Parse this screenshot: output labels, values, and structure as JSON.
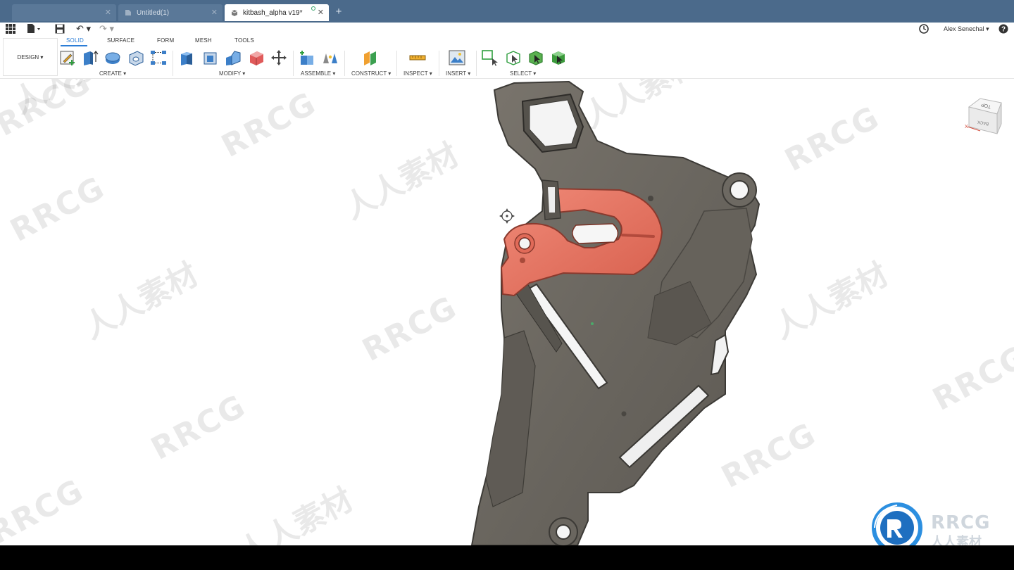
{
  "tabs": [
    {
      "label": "",
      "active": false
    },
    {
      "label": "Untitled(1)",
      "active": false
    },
    {
      "label": "kitbash_alpha v19*",
      "active": true
    }
  ],
  "user": {
    "name": "Alex Senechal"
  },
  "workspace": {
    "label": "DESIGN"
  },
  "ribbon_tabs": [
    {
      "label": "SOLID",
      "active": true
    },
    {
      "label": "SURFACE",
      "active": false
    },
    {
      "label": "FORM",
      "active": false
    },
    {
      "label": "MESH",
      "active": false
    },
    {
      "label": "TOOLS",
      "active": false
    }
  ],
  "groups": {
    "create": "CREATE",
    "modify": "MODIFY",
    "assemble": "ASSEMBLE",
    "construct": "CONSTRUCT",
    "inspect": "INSPECT",
    "insert": "INSERT",
    "select": "SELECT"
  },
  "viewcube": {
    "top": "TOP",
    "back": "BACK",
    "x": "X"
  },
  "watermark": {
    "en": "RRCG",
    "cn": "人人素材"
  },
  "colors": {
    "tabbar": "#4b6a8b",
    "accent": "#2b7dd6",
    "model_body": "#6e6a63",
    "model_highlight": "#e8705e"
  }
}
